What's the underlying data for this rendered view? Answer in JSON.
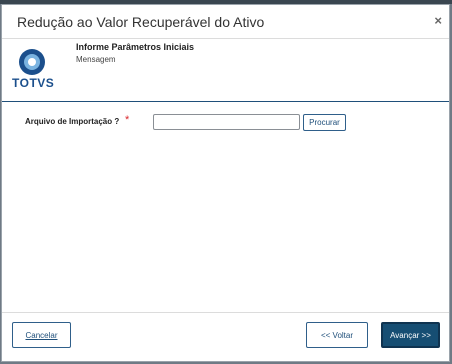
{
  "dialog": {
    "title": "Redução ao Valor Recuperável do Ativo",
    "close_glyph": "×"
  },
  "logo": {
    "text": "TOTVS",
    "colors": {
      "blue": "#1b4f8c",
      "light_blue": "#7ab3e0"
    }
  },
  "header": {
    "section_title": "Informe Parâmetros Iniciais",
    "section_subtitle": "Mensagem"
  },
  "form": {
    "import_file_label": "Arquivo de Importação ?",
    "required_mark": "*",
    "import_file_value": "",
    "browse_button": "Procurar"
  },
  "footer": {
    "cancel_label": "Cancelar",
    "back_label": "<< Voltar",
    "next_label": "Avançar >>"
  },
  "colors": {
    "primary": "#164e73",
    "required": "#d9262b",
    "divider": "#1f4f7a"
  },
  "icons": [
    "close-icon",
    "totvs-logo-icon"
  ]
}
